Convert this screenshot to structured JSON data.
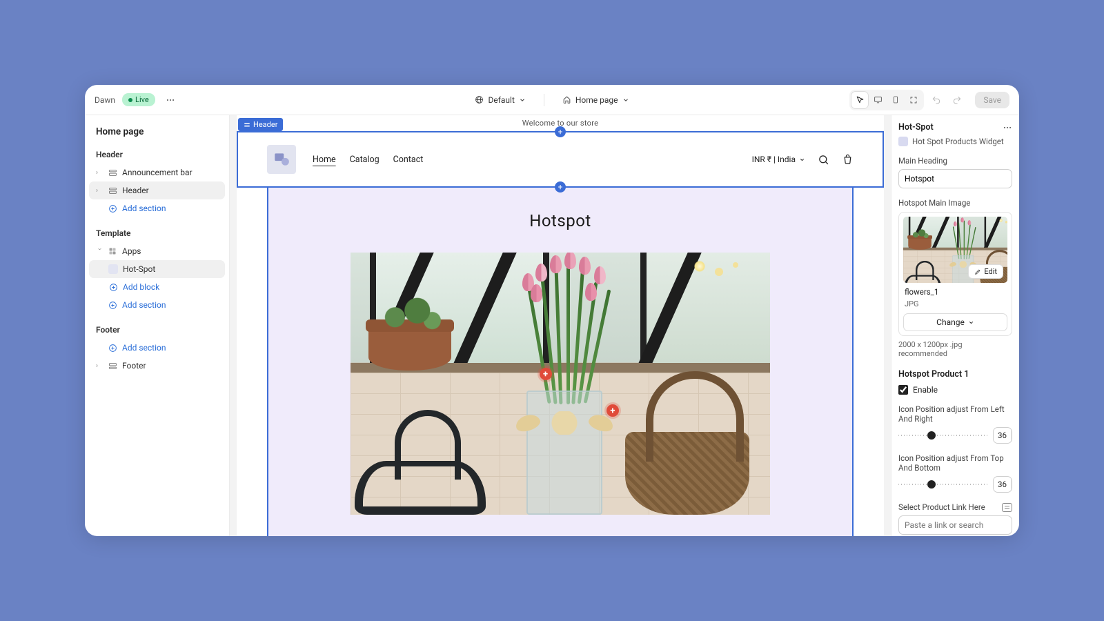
{
  "topbar": {
    "theme_name": "Dawn",
    "status_label": "Live",
    "template_label": "Default",
    "page_label": "Home page",
    "save_label": "Save"
  },
  "left": {
    "title": "Home page",
    "group_header": "Header",
    "announcement": "Announcement bar",
    "header": "Header",
    "add_section": "Add section",
    "group_template": "Template",
    "apps": "Apps",
    "hotspot": "Hot-Spot",
    "add_block": "Add block",
    "group_footer": "Footer",
    "footer": "Footer"
  },
  "canvas": {
    "sel_label": "Header",
    "announcement": "Welcome to our store",
    "nav_home": "Home",
    "nav_catalog": "Catalog",
    "nav_contact": "Contact",
    "currency": "INR ₹ | India",
    "hotspot_heading": "Hotspot"
  },
  "right": {
    "title": "Hot-Spot",
    "subtitle": "Hot Spot Products Widget",
    "main_heading_label": "Main Heading",
    "main_heading_value": "Hotspot",
    "image_label": "Hotspot Main Image",
    "edit_label": "Edit",
    "file_name": "flowers_1",
    "file_type": "JPG",
    "change_label": "Change",
    "hint": "2000 x 1200px .jpg recommended",
    "product1_label": "Hotspot Product 1",
    "enable_label": "Enable",
    "pos_lr_label": "Icon Position adjust From Left And Right",
    "pos_lr_value": "36",
    "pos_tb_label": "Icon Position adjust From Top And Bottom",
    "pos_tb_value": "36",
    "percent_unit": "%",
    "select_link_label": "Select Product Link Here",
    "link_placeholder": "Paste a link or search"
  }
}
